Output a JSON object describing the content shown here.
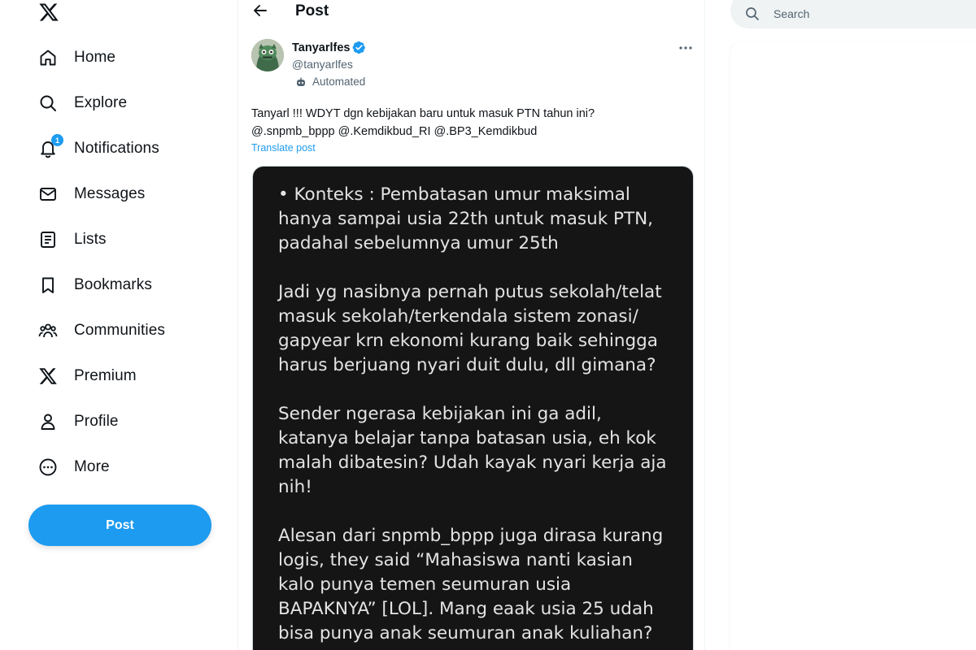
{
  "sidebar": {
    "logo_icon": "x-logo-icon",
    "items": [
      {
        "label": "Home",
        "icon": "home-icon"
      },
      {
        "label": "Explore",
        "icon": "search-icon"
      },
      {
        "label": "Notifications",
        "icon": "bell-icon",
        "badge": "1"
      },
      {
        "label": "Messages",
        "icon": "envelope-icon"
      },
      {
        "label": "Lists",
        "icon": "list-icon"
      },
      {
        "label": "Bookmarks",
        "icon": "bookmark-icon"
      },
      {
        "label": "Communities",
        "icon": "people-icon"
      },
      {
        "label": "Premium",
        "icon": "x-logo-icon"
      },
      {
        "label": "Profile",
        "icon": "person-icon"
      },
      {
        "label": "More",
        "icon": "more-circle-icon"
      }
    ],
    "post_button": "Post"
  },
  "main": {
    "header_title": "Post",
    "post": {
      "author_name": "Tanyarlfes",
      "author_handle": "@tanyarlfes",
      "automated_label": "Automated",
      "text_line1": "Tanyarl !!! WDYT dgn kebijakan baru untuk masuk PTN tahun ini?",
      "text_line2": "@.snpmb_bppp @.Kemdikbud_RI @.BP3_Kemdikbud",
      "translate_label": "Translate post",
      "media_paragraphs": [
        "• Konteks : Pembatasan umur maksimal\nhanya sampai usia 22th untuk masuk PTN,\npadahal sebelumnya umur 25th",
        "Jadi yg nasibnya pernah putus sekolah/telat\nmasuk sekolah/terkendala sistem zonasi/\ngapyear krn ekonomi kurang baik sehingga\nharus berjuang nyari duit dulu, dll gimana?",
        "Sender ngerasa kebijakan ini ga adil,\nkatanya belajar tanpa batasan usia, eh kok\nmalah dibatesin? Udah kayak nyari kerja aja\nnih!",
        "Alesan dari snpmb_bppp juga dirasa kurang\nlogis, they said “Mahasiswa nanti kasian\nkalo punya temen seumuran usia\nBAPAKNYA” [LOL]. Mang eaak usia 25 udah\nbisa punya anak seumuran anak kuliahan?"
      ]
    }
  },
  "right": {
    "search_placeholder": "Search"
  },
  "colors": {
    "accent": "#1d9bf0",
    "text_primary": "#0f1419",
    "text_secondary": "#536471",
    "media_background": "#151515"
  }
}
